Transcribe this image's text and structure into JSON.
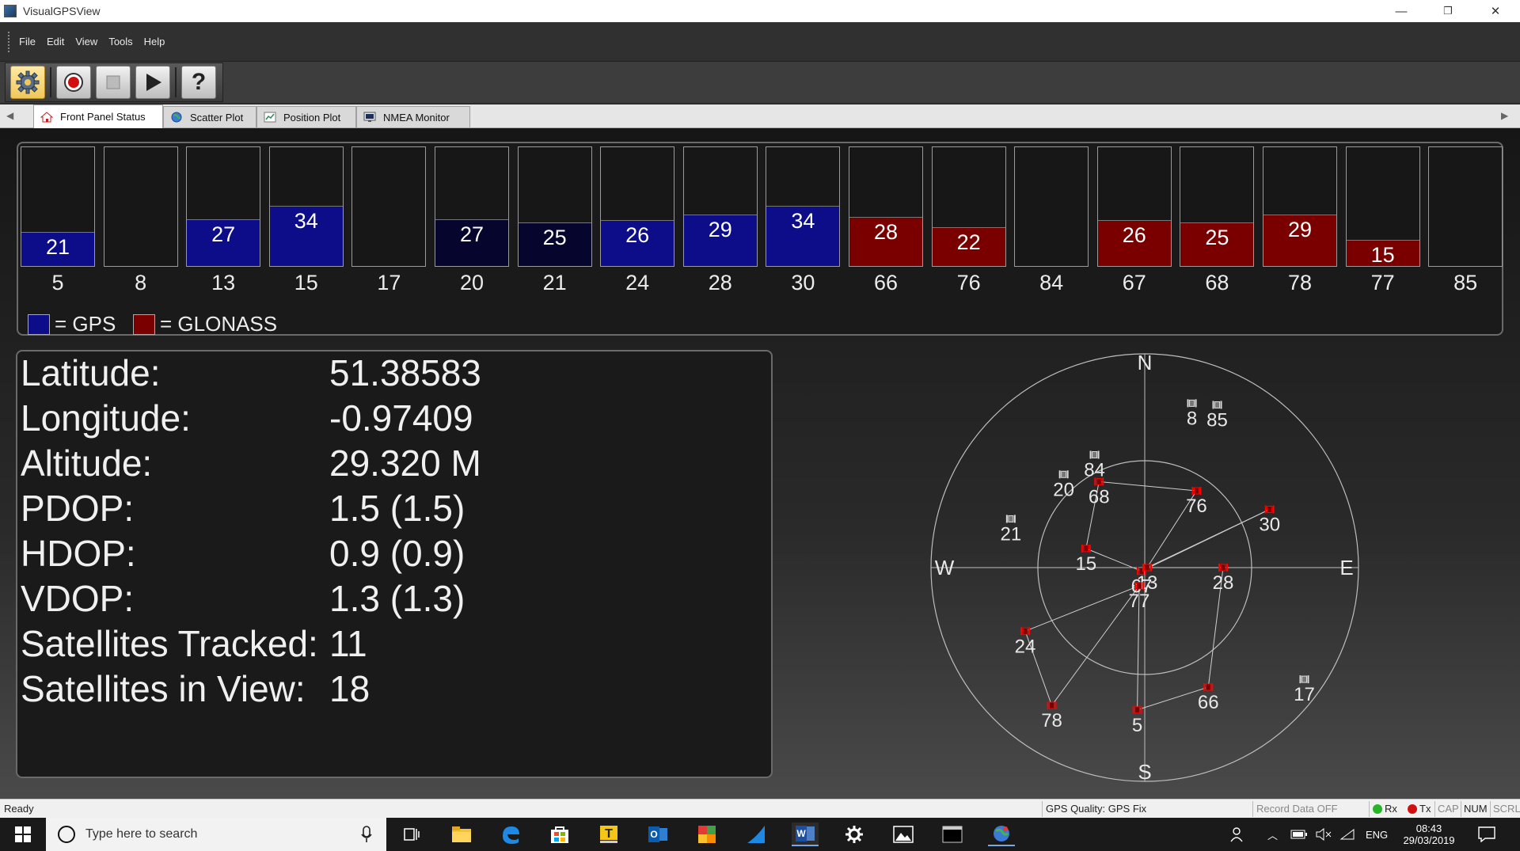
{
  "window": {
    "title": "VisualGPSView",
    "minimize": "—",
    "restore": "❐",
    "close": "✕"
  },
  "menu": [
    "File",
    "Edit",
    "View",
    "Tools",
    "Help"
  ],
  "toolbar": {
    "buttons": [
      "settings-icon",
      "record-icon",
      "stop-icon",
      "play-icon",
      "help-icon"
    ],
    "help_glyph": "?"
  },
  "tabs": [
    {
      "label": "Front Panel Status",
      "icon": "home-icon"
    },
    {
      "label": "Scatter Plot",
      "icon": "globe-icon"
    },
    {
      "label": "Position Plot",
      "icon": "chart-icon"
    },
    {
      "label": "NMEA Monitor",
      "icon": "monitor-icon"
    }
  ],
  "colors": {
    "gps": "#0d0d8a",
    "gps_dim": "#05052e",
    "glonass": "#7a0000",
    "accent": "#ff0000"
  },
  "signal_bars": [
    {
      "prn": "5",
      "snr": "21",
      "system": "gps",
      "level": 0.28
    },
    {
      "prn": "8",
      "snr": "",
      "system": "none",
      "level": 0
    },
    {
      "prn": "13",
      "snr": "27",
      "system": "gps",
      "level": 0.39
    },
    {
      "prn": "15",
      "snr": "34",
      "system": "gps",
      "level": 0.5
    },
    {
      "prn": "17",
      "snr": "",
      "system": "none",
      "level": 0
    },
    {
      "prn": "20",
      "snr": "27",
      "system": "gps_dim",
      "level": 0.39
    },
    {
      "prn": "21",
      "snr": "25",
      "system": "gps_dim",
      "level": 0.36
    },
    {
      "prn": "24",
      "snr": "26",
      "system": "gps",
      "level": 0.38
    },
    {
      "prn": "28",
      "snr": "29",
      "system": "gps",
      "level": 0.43
    },
    {
      "prn": "30",
      "snr": "34",
      "system": "gps",
      "level": 0.5
    },
    {
      "prn": "66",
      "snr": "28",
      "system": "glonass",
      "level": 0.41
    },
    {
      "prn": "76",
      "snr": "22",
      "system": "glonass",
      "level": 0.32
    },
    {
      "prn": "84",
      "snr": "",
      "system": "none",
      "level": 0
    },
    {
      "prn": "67",
      "snr": "26",
      "system": "glonass",
      "level": 0.38
    },
    {
      "prn": "68",
      "snr": "25",
      "system": "glonass",
      "level": 0.36
    },
    {
      "prn": "78",
      "snr": "29",
      "system": "glonass",
      "level": 0.43
    },
    {
      "prn": "77",
      "snr": "15",
      "system": "glonass",
      "level": 0.22
    },
    {
      "prn": "85",
      "snr": "",
      "system": "none",
      "level": 0
    }
  ],
  "legend": {
    "gps": "= GPS",
    "glonass": "= GLONASS"
  },
  "info": [
    {
      "label": "Latitude:",
      "value": "51.38583"
    },
    {
      "label": "Longitude:",
      "value": "-0.97409"
    },
    {
      "label": "Altitude:",
      "value": "29.320 M"
    },
    {
      "label": "PDOP:",
      "value": "1.5 (1.5)"
    },
    {
      "label": "HDOP:",
      "value": "0.9 (0.9)"
    },
    {
      "label": "VDOP:",
      "value": "1.3 (1.3)"
    },
    {
      "label": "Satellites Tracked:",
      "value": "11"
    },
    {
      "label": "Satellites in View:",
      "value": "18"
    }
  ],
  "skyplot": {
    "compass": {
      "n": "N",
      "s": "S",
      "e": "E",
      "w": "W"
    },
    "satellites": [
      {
        "prn": "84",
        "azimuth": 336,
        "elevation": 38,
        "used": false
      },
      {
        "prn": "8",
        "azimuth": 16,
        "elevation": 18,
        "used": false
      },
      {
        "prn": "85",
        "azimuth": 24,
        "elevation": 15,
        "used": false
      },
      {
        "prn": "20",
        "azimuth": 319,
        "elevation": 38,
        "used": false
      },
      {
        "prn": "21",
        "azimuth": 290,
        "elevation": 30,
        "used": false
      },
      {
        "prn": "17",
        "azimuth": 125,
        "elevation": 8,
        "used": false
      },
      {
        "prn": "68",
        "azimuth": 332,
        "elevation": 49,
        "used": true
      },
      {
        "prn": "76",
        "azimuth": 34,
        "elevation": 51,
        "used": true
      },
      {
        "prn": "30",
        "azimuth": 65,
        "elevation": 32,
        "used": true
      },
      {
        "prn": "15",
        "azimuth": 288,
        "elevation": 64,
        "used": true
      },
      {
        "prn": "67",
        "azimuth": 222,
        "elevation": 88,
        "used": true
      },
      {
        "prn": "13",
        "azimuth": 90,
        "elevation": 89,
        "used": true
      },
      {
        "prn": "28",
        "azimuth": 90,
        "elevation": 57,
        "used": true
      },
      {
        "prn": "77",
        "azimuth": 197,
        "elevation": 82,
        "used": true
      },
      {
        "prn": "24",
        "azimuth": 242,
        "elevation": 33,
        "used": true
      },
      {
        "prn": "78",
        "azimuth": 214,
        "elevation": 20,
        "used": true
      },
      {
        "prn": "5",
        "azimuth": 183,
        "elevation": 30,
        "used": true
      },
      {
        "prn": "66",
        "azimuth": 152,
        "elevation": 33,
        "used": true
      }
    ],
    "links": [
      [
        "68",
        "76"
      ],
      [
        "76",
        "13"
      ],
      [
        "68",
        "15"
      ],
      [
        "15",
        "67"
      ],
      [
        "67",
        "13"
      ],
      [
        "13",
        "30"
      ],
      [
        "30",
        "67"
      ],
      [
        "13",
        "28"
      ],
      [
        "28",
        "66"
      ],
      [
        "66",
        "5"
      ],
      [
        "5",
        "77"
      ],
      [
        "77",
        "24"
      ],
      [
        "24",
        "78"
      ],
      [
        "78",
        "77"
      ]
    ]
  },
  "status": {
    "ready": "Ready",
    "gps_quality": "GPS Quality: GPS Fix",
    "record": "Record Data OFF",
    "rx": "Rx",
    "tx": "Tx",
    "cap": "CAP",
    "num": "NUM",
    "scrl": "SCRL"
  },
  "taskbar": {
    "search_placeholder": "Type here to search",
    "lang": "ENG",
    "time": "08:43",
    "date": "29/03/2019"
  }
}
